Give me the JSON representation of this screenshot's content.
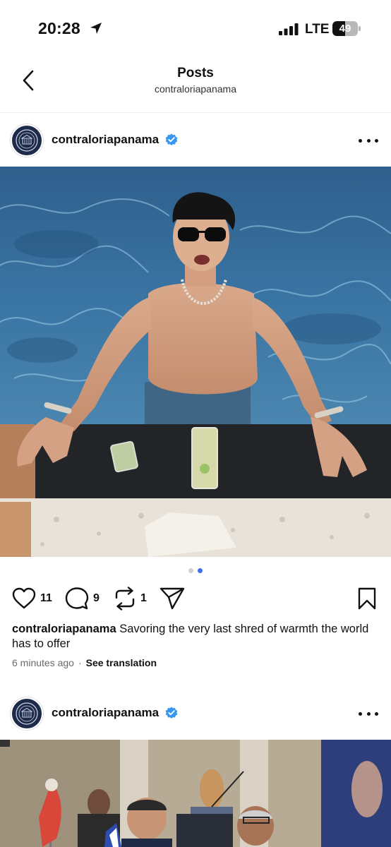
{
  "status_bar": {
    "time": "20:28",
    "network": "LTE",
    "battery": "49",
    "battery_level": 0.49
  },
  "header": {
    "title": "Posts",
    "subtitle": "contraloriapanama"
  },
  "posts": [
    {
      "username": "contraloriapanama",
      "likes": "11",
      "comments": "9",
      "reposts": "1",
      "caption_user": "contraloriapanama",
      "caption_text": "Savoring the very last shred of warmth the world has to offer",
      "time_ago": "6 minutes ago",
      "translate_label": "See translation"
    },
    {
      "username": "contraloriapanama"
    }
  ],
  "colors": {
    "verified": "#3897f0",
    "active_dot": "#3f6fe8",
    "avatar_bg": "#1e2a4a"
  },
  "icons": [
    "location-arrow-icon",
    "signal-icon",
    "battery-icon",
    "back-chevron-icon",
    "verified-badge-icon",
    "more-dots-icon",
    "heart-icon",
    "comment-icon",
    "repost-icon",
    "share-icon",
    "bookmark-icon"
  ]
}
